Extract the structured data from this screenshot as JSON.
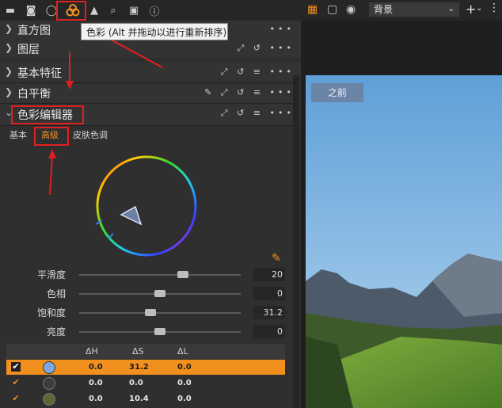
{
  "tabs": [
    "folder-icon",
    "camera-icon",
    "lens-icon",
    "color-icon",
    "exposure-icon",
    "search-icon",
    "clipboard-icon",
    "info-icon"
  ],
  "tooltip": "色彩 (Alt 并拖动以进行重新排序)",
  "sections": {
    "histogram": "直方图",
    "layers": "图层",
    "basic": "基本特征",
    "white_balance": "白平衡",
    "color_editor": "色彩编辑器"
  },
  "subtabs": {
    "basic": "基本",
    "advanced": "高级",
    "skin": "皮肤色调"
  },
  "sliders": [
    {
      "label": "平滑度",
      "value": "20",
      "level": 0.64
    },
    {
      "label": "色相",
      "value": "0",
      "level": 0.5
    },
    {
      "label": "饱和度",
      "value": "31.2",
      "level": 0.44
    },
    {
      "label": "亮度",
      "value": "0",
      "level": 0.5
    }
  ],
  "table": {
    "headers": [
      "ΔH",
      "ΔS",
      "ΔL"
    ],
    "rows": [
      {
        "checked": true,
        "color": "#7fa8e0",
        "dh": "0.0",
        "ds": "31.2",
        "dl": "0.0",
        "selected": true
      },
      {
        "checked": true,
        "color": "#3a3f38",
        "dh": "0.0",
        "ds": "0.0",
        "dl": "0.0",
        "selected": false
      },
      {
        "checked": true,
        "color": "#5b6a34",
        "dh": "0.0",
        "ds": "10.4",
        "dl": "0.0",
        "selected": false
      }
    ]
  },
  "viewer": {
    "layer_select": "背景",
    "before_label": "之前"
  },
  "colors": {
    "accent": "#f2901e",
    "highlight_red": "#e02020"
  }
}
